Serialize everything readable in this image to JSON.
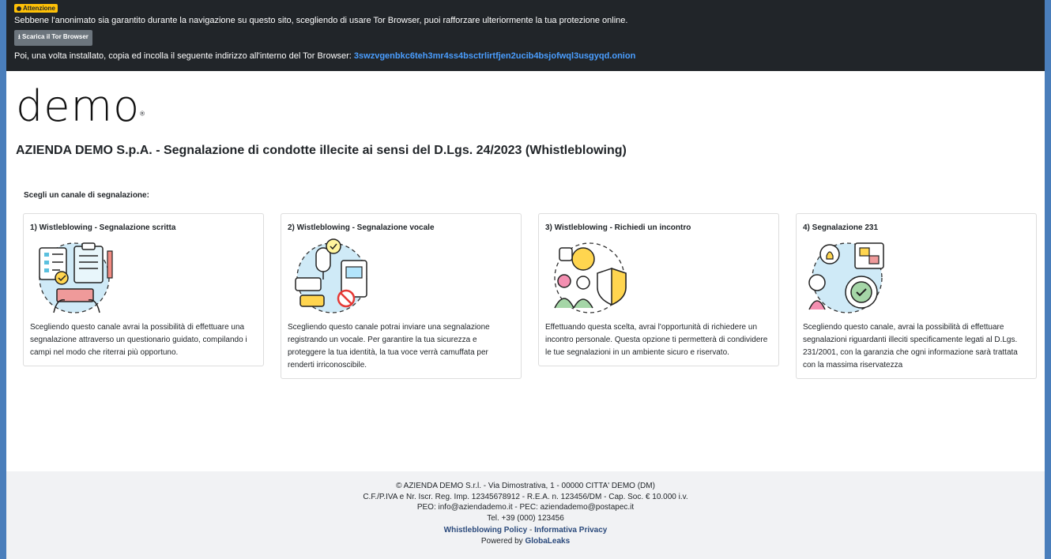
{
  "tor": {
    "badge": "Attenzione",
    "line1": "Sebbene l'anonimato sia garantito durante la navigazione su questo sito, scegliendo di usare Tor Browser, puoi rafforzare ulteriormente la tua protezione online.",
    "button": "Scarica il Tor Browser",
    "line2": "Poi, una volta installato, copia ed incolla il seguente indirizzo all'interno del Tor Browser:",
    "onion": "3swzvgenbkc6teh3mr4ss4bsctrlirtfjen2ucib4bsjofwql3usgyqd.onion"
  },
  "logo": "demo",
  "title": "AZIENDA DEMO S.p.A. - Segnalazione di condotte illecite ai sensi del D.Lgs. 24/2023 (Whistleblowing)",
  "choose": "Scegli un canale di segnalazione:",
  "cards": [
    {
      "title": "1) Wistleblowing - Segnalazione scritta",
      "text": "Scegliendo questo canale avrai la possibilità di effettuare una segnalazione attraverso un questionario guidato, compilando i campi nel modo che riterrai più opportuno."
    },
    {
      "title": "2) Wistleblowing - Segnalazione vocale",
      "text": "Scegliendo questo canale potrai inviare una segnalazione registrando un vocale. Per garantire la tua sicurezza e proteggere la tua identità, la tua voce verrà camuffata per renderti irriconoscibile."
    },
    {
      "title": "3) Wistleblowing - Richiedi un incontro",
      "text": "Effettuando questa scelta, avrai l'opportunità di richiedere un incontro personale. Questa opzione ti permetterà di condividere le tue segnalazioni in un ambiente sicuro e riservato."
    },
    {
      "title": "4) Segnalazione 231",
      "text": "Scegliendo questo canale, avrai la possibilità di effettuare segnalazioni riguardanti illeciti specificamente legati al D.Lgs. 231/2001, con la garanzia che ogni informazione sarà trattata con la massima riservatezza"
    }
  ],
  "footer": {
    "line1": "© AZIENDA DEMO S.r.l. - Via Dimostrativa, 1 - 00000 CITTA' DEMO (DM)",
    "line2": "C.F./P.IVA e Nr. Iscr. Reg. Imp.  12345678912 - R.E.A. n. 123456/DM - Cap. Soc. € 10.000 i.v.",
    "line3": "PEO: info@aziendademo.it - PEC: aziendademo@postapec.it",
    "line4": "Tel. +39 (000) 123456",
    "policy": "Whistleblowing Policy",
    "sep": " - ",
    "privacy": "Informativa Privacy",
    "powered": "Powered by ",
    "globaleaks": "GlobaLeaks"
  }
}
